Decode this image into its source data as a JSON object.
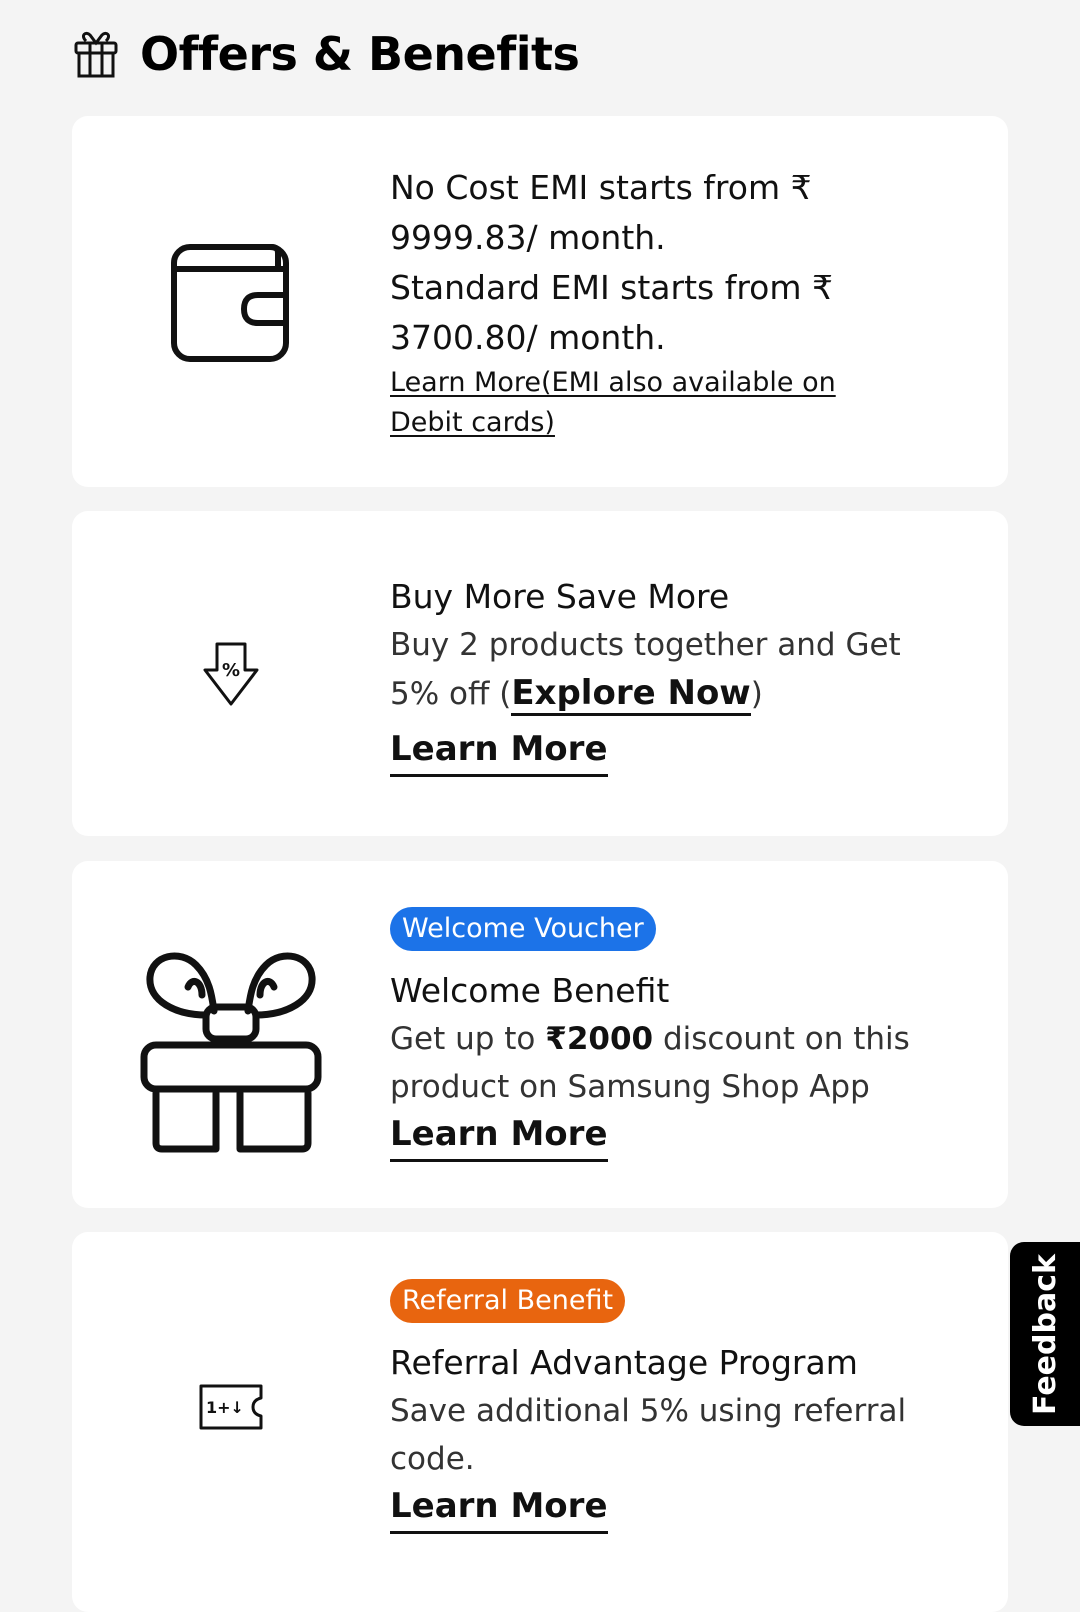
{
  "header": {
    "title": "Offers & Benefits"
  },
  "emi_card": {
    "line1": "No Cost EMI starts from ₹",
    "line2": "9999.83/ month.",
    "line3": "Standard EMI starts from ₹",
    "line4": "3700.80/ month.",
    "link_line1": "Learn More(EMI also available on",
    "link_line2": "Debit cards)"
  },
  "buy_more_card": {
    "title": "Buy More Save More",
    "desc_line1": "Buy 2 products together and Get",
    "desc_prefix": "5% off (",
    "explore": "Explore Now",
    "desc_suffix": ")",
    "learn_more": "Learn More",
    "icon_text": "%"
  },
  "welcome_card": {
    "badge": "Welcome Voucher",
    "badge_color": "#1c73e8",
    "title": "Welcome Benefit",
    "desc_prefix": "Get up to ",
    "amount": "₹2000",
    "desc_suffix": " discount on this",
    "desc_line2": "product on Samsung Shop App",
    "learn_more": "Learn More"
  },
  "referral_card": {
    "badge": "Referral Benefit",
    "badge_color": "#e8650f",
    "title": "Referral Advantage Program",
    "desc_line1": "Save additional 5% using referral",
    "desc_line2": "code.",
    "learn_more": "Learn More",
    "icon_text": "1+↓"
  },
  "feedback": {
    "label": "Feedback"
  }
}
